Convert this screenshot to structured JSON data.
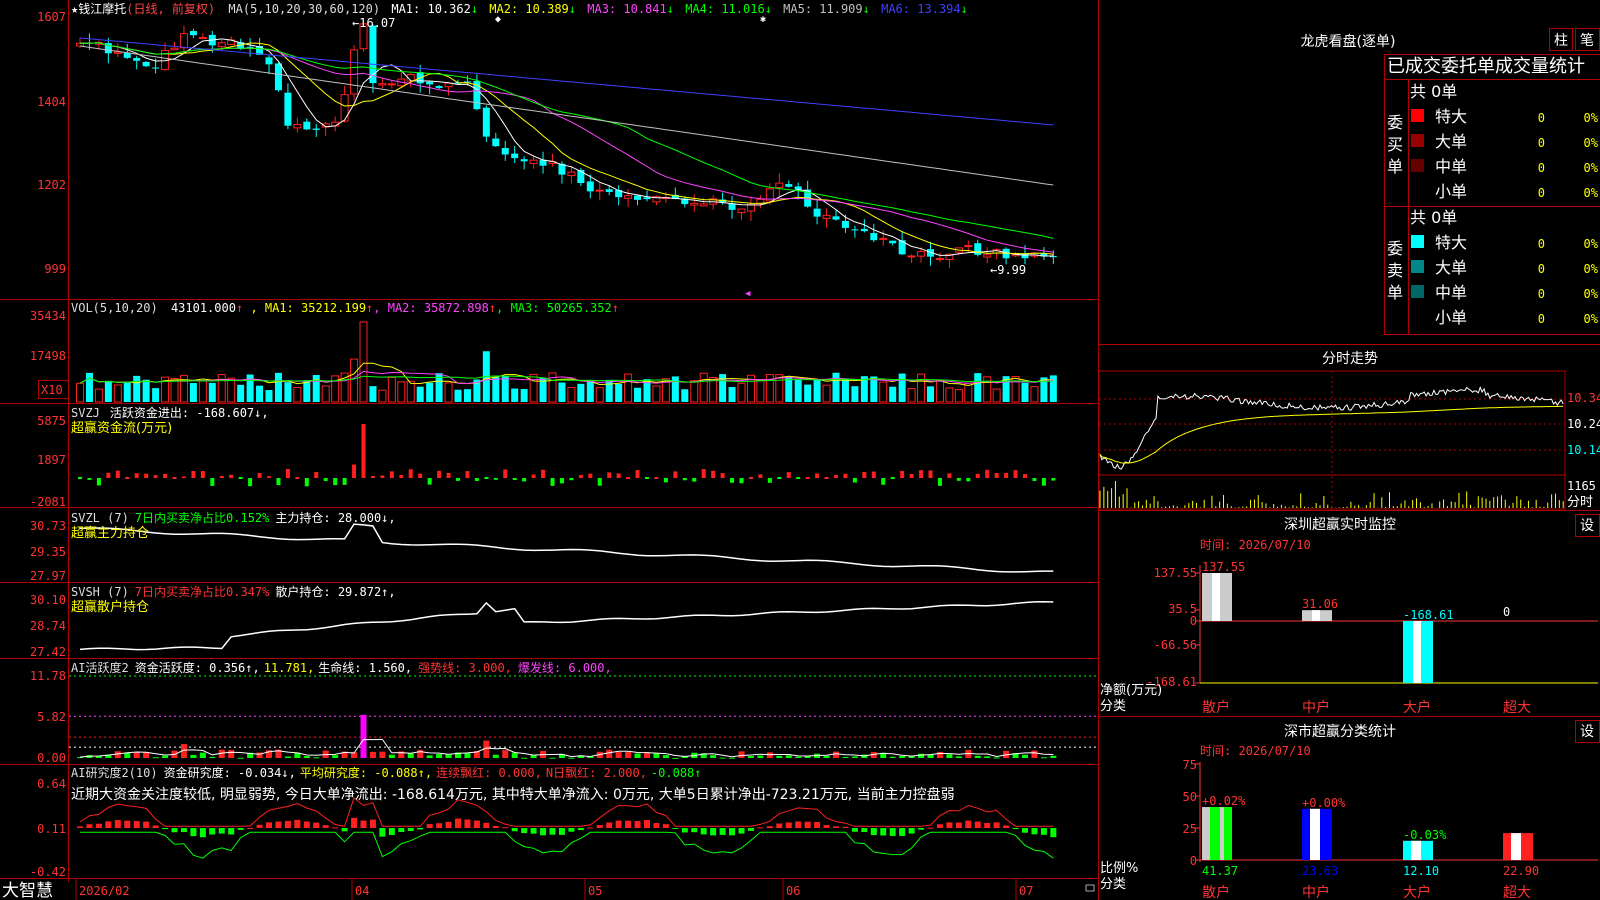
{
  "app": {
    "logo": "大智慧",
    "star": "★",
    "stock_name": "钱江摩托",
    "period": "(日线, 前复权)"
  },
  "kline": {
    "ma_label": "MA(5,10,20,30,60,120)",
    "mas": [
      {
        "name": "MA1",
        "value": "10.362",
        "arrow": "↓",
        "color": "#ffffff"
      },
      {
        "name": "MA2",
        "value": "10.389",
        "arrow": "↓",
        "color": "#ffff00"
      },
      {
        "name": "MA3",
        "value": "10.841",
        "arrow": "↓",
        "color": "#ff44ff"
      },
      {
        "name": "MA4",
        "value": "11.016",
        "arrow": "↓",
        "color": "#00ff00"
      },
      {
        "name": "MA5",
        "value": "11.909",
        "arrow": "↓",
        "color": "#c0c0c0"
      },
      {
        "name": "MA6",
        "value": "13.394",
        "arrow": "↓",
        "color": "#4040ff"
      }
    ],
    "y_ticks": [
      "1607",
      "1404",
      "1202",
      "999"
    ],
    "high_label": "←16.07",
    "low_label": "←9.99"
  },
  "vol": {
    "label": "VOL(5,10,20)",
    "value": "43101.000",
    "arrow": "↑",
    "mas": [
      {
        "name": "MA1",
        "value": "35212.199",
        "arrow": "↑",
        "color": "#ffff00"
      },
      {
        "name": "MA2",
        "value": "35872.898",
        "arrow": "↑",
        "color": "#ff44ff"
      },
      {
        "name": "MA3",
        "value": "50265.352",
        "arrow": "↑",
        "color": "#00ff00"
      }
    ],
    "y_ticks": [
      "35434",
      "17498"
    ],
    "unit": "X10"
  },
  "svzj": {
    "label": "SVZJ",
    "desc": "活跃资金进出: -168.607↓,",
    "sub": "超赢资金流(万元)",
    "y_ticks": [
      "5875",
      "1897",
      "-2081"
    ]
  },
  "svzl": {
    "label": "SVZL (7)",
    "ratio": "7日内买卖净占比0.152%",
    "hold": "主力持仓: 28.000↓,",
    "sub": "超赢主力持仓",
    "y_ticks": [
      "30.73",
      "29.35",
      "27.97"
    ]
  },
  "svsh": {
    "label": "SVSH (7)",
    "ratio": "7日内买卖净占比0.347%",
    "hold": "散户持仓: 29.872↑,",
    "sub": "超赢散户持仓",
    "y_ticks": [
      "30.10",
      "28.74",
      "27.42"
    ]
  },
  "ai1": {
    "label": "AI活跃度2",
    "desc": "资金活跃度: 0.356↑,",
    "v2": "11.781,",
    "life": "生命线: 1.560,",
    "strong": "强势线: 3.000,",
    "burst": "爆发线: 6.000,",
    "y_ticks": [
      "11.78",
      "5.82",
      "0.00"
    ]
  },
  "ai2": {
    "label": "AI研究度2(10)",
    "research": "资金研究度: -0.034↓,",
    "avg": "平均研究度: -0.088↑,",
    "lh": "连续飘红: 0.000,",
    "nh": "N日飘红: 2.000,",
    "last": "-0.088↑",
    "comment": "近期大资金关注度较低, 明显弱势, 今日大单净流出: -168.614万元, 其中特大单净流入: 0万元, 大单5日累计净出-723.21万元, 当前主力控盘弱",
    "y_ticks": [
      "0.64",
      "0.11",
      "-0.42"
    ]
  },
  "xaxis": {
    "labels": [
      "2026/02",
      "04",
      "05",
      "06",
      "07"
    ]
  },
  "right": {
    "lhb_title": "龙虎看盘(逐单)",
    "btn_zhu": "柱",
    "btn_bi": "笔",
    "tabs": "已成交委托单成交量统计",
    "buy": {
      "side": [
        "委",
        "买",
        "单"
      ],
      "total": "共 0单",
      "rows": [
        {
          "label": "特大",
          "value": "0",
          "pct": "0%",
          "color": "#ff0000"
        },
        {
          "label": "大单",
          "value": "0",
          "pct": "0%",
          "color": "#990000"
        },
        {
          "label": "中单",
          "value": "0",
          "pct": "0%",
          "color": "#660000"
        },
        {
          "label": "小单",
          "value": "0",
          "pct": "0%",
          "color": ""
        }
      ]
    },
    "sell": {
      "side": [
        "委",
        "卖",
        "单"
      ],
      "total": "共 0单",
      "rows": [
        {
          "label": "特大",
          "value": "0",
          "pct": "0%",
          "color": "#00ffff"
        },
        {
          "label": "大单",
          "value": "0",
          "pct": "0%",
          "color": "#008888"
        },
        {
          "label": "中单",
          "value": "0",
          "pct": "0%",
          "color": "#006666"
        },
        {
          "label": "小单",
          "value": "0",
          "pct": "0%",
          "color": ""
        }
      ]
    },
    "intraday": {
      "title": "分时走势",
      "price_ticks": [
        "10.34",
        "10.24",
        "10.14"
      ],
      "vol_tick": "1165",
      "label": "分时"
    },
    "monitor": {
      "title": "深圳超赢实时监控",
      "btn": "设",
      "time": "时间: 2026/07/10",
      "ylabel": "净额(万元)",
      "xlabel": "分类",
      "y_ticks": [
        "137.55",
        "35.5",
        "0",
        "-66.56",
        "-168.61"
      ],
      "categories": [
        "散户",
        "中户",
        "大户",
        "超大"
      ],
      "values": [
        "137.55",
        "31.06",
        "-168.61",
        "0"
      ]
    },
    "classify": {
      "title": "深市超赢分类统计",
      "btn": "设",
      "time": "时间: 2026/07/10",
      "ylabel": "比例%",
      "xlabel": "分类",
      "y_ticks": [
        "75",
        "50",
        "25",
        "0"
      ],
      "categories": [
        "散户",
        "中户",
        "大户",
        "超大"
      ],
      "changes": [
        "+0.02%",
        "+0.00%",
        "-0.03%",
        ""
      ],
      "values": [
        "41.37",
        "23.63",
        "12.10",
        "22.90"
      ]
    }
  },
  "chart_data": {
    "type": "bar",
    "title": "深市超赢分类统计",
    "categories": [
      "散户",
      "中户",
      "大户",
      "超大"
    ],
    "series": [
      {
        "name": "比例%",
        "values": [
          41.37,
          23.63,
          12.1,
          22.9
        ]
      },
      {
        "name": "净额(万元)",
        "values": [
          137.55,
          31.06,
          -168.61,
          0
        ]
      }
    ],
    "ylim": [
      0,
      75
    ]
  }
}
